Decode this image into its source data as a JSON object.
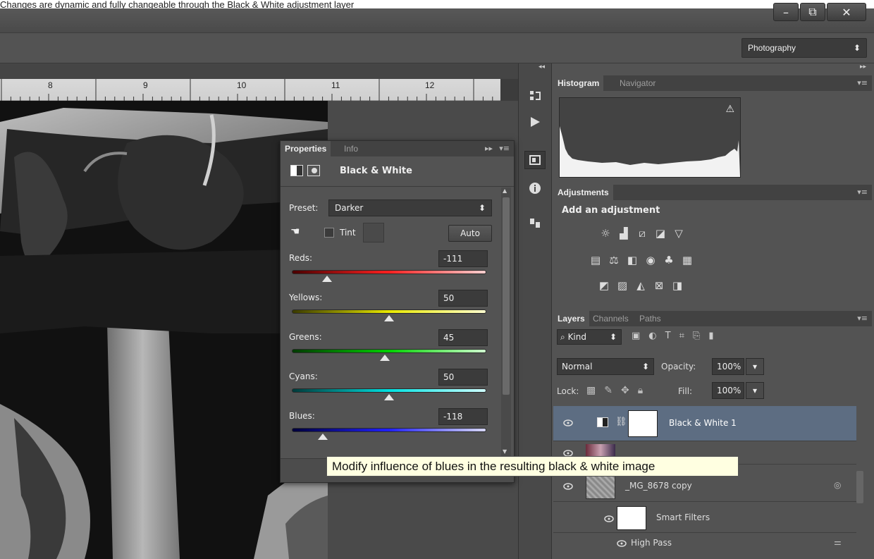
{
  "caption": "Changes are dynamic and fully changeable through the Black & White adjustment layer",
  "window": {
    "minimize": "–",
    "restore": "⧉",
    "close": "✕",
    "workspace": "Photography"
  },
  "ruler": {
    "marks": [
      "8",
      "9",
      "10",
      "11",
      "12"
    ]
  },
  "properties": {
    "tabs": [
      "Properties",
      "Info"
    ],
    "title": "Black & White",
    "preset_label": "Preset:",
    "preset_value": "Darker",
    "tint_label": "Tint",
    "auto_label": "Auto",
    "sliders": [
      {
        "label": "Reds:",
        "value": "-111",
        "fraction": 0.18,
        "gradient": [
          "#4a0000",
          "#ff2020",
          "#ffd0d0"
        ]
      },
      {
        "label": "Yellows:",
        "value": "50",
        "fraction": 0.5,
        "gradient": [
          "#3a3a00",
          "#e8e800",
          "#ffffd0"
        ]
      },
      {
        "label": "Greens:",
        "value": "45",
        "fraction": 0.48,
        "gradient": [
          "#003a00",
          "#00d000",
          "#d0ffd0"
        ]
      },
      {
        "label": "Cyans:",
        "value": "50",
        "fraction": 0.5,
        "gradient": [
          "#003a3a",
          "#00e0e0",
          "#d0ffff"
        ]
      },
      {
        "label": "Blues:",
        "value": "-118",
        "fraction": 0.16,
        "gradient": [
          "#00003a",
          "#2020ff",
          "#d8d8ff"
        ]
      }
    ]
  },
  "tooltip": "Modify influence of blues in the resulting black & white image",
  "histogram": {
    "tabs": [
      "Histogram",
      "Navigator"
    ],
    "warning": "⚠"
  },
  "adjustments": {
    "tab": "Adjustments",
    "heading": "Add an adjustment"
  },
  "layers": {
    "tabs": [
      "Layers",
      "Channels",
      "Paths"
    ],
    "kind_label": "Kind",
    "blend_mode": "Normal",
    "opacity_label": "Opacity:",
    "opacity_value": "100%",
    "lock_label": "Lock:",
    "fill_label": "Fill:",
    "fill_value": "100%",
    "rows": [
      {
        "name": "Black & White 1",
        "selected": true
      },
      {
        "name": "",
        "selected": false
      },
      {
        "name": "_MG_8678 copy",
        "selected": false
      },
      {
        "name": "Smart Filters",
        "selected": false
      },
      {
        "name": "High Pass",
        "selected": false
      }
    ]
  }
}
